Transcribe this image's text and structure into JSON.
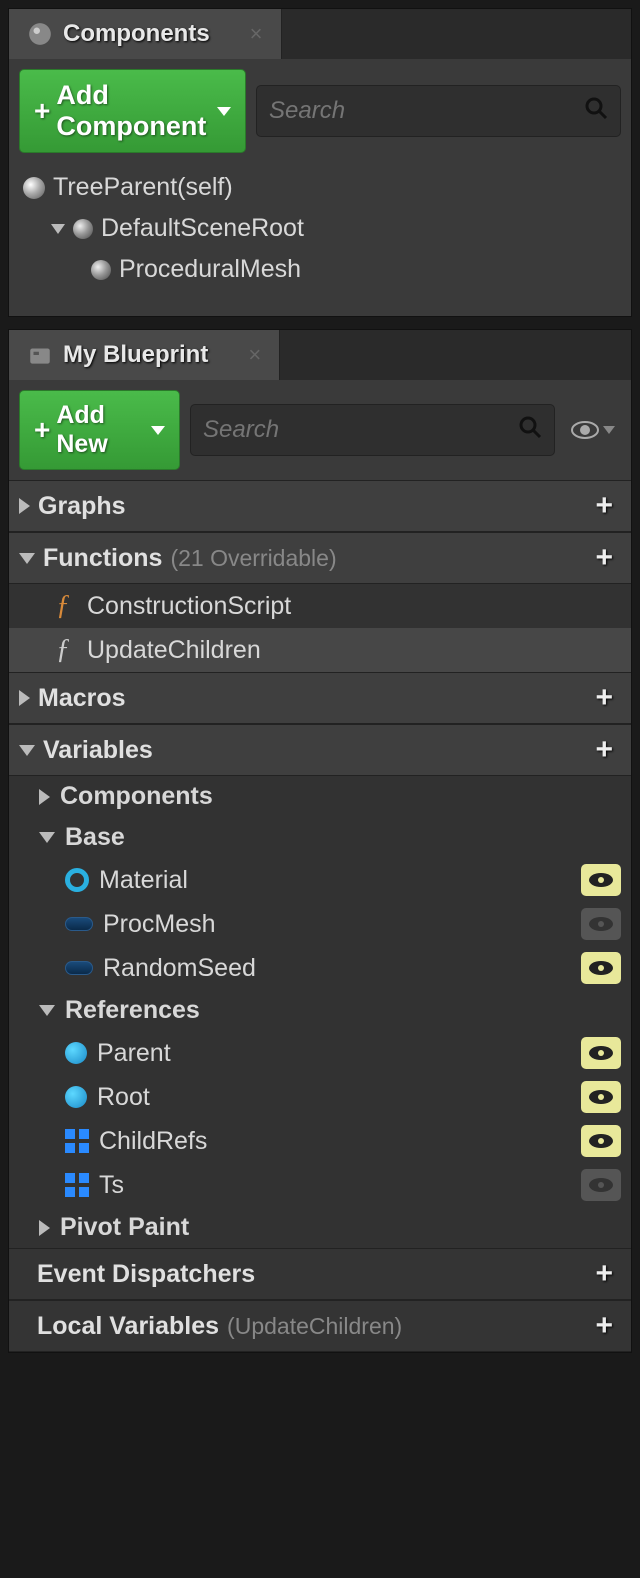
{
  "components": {
    "tab_title": "Components",
    "add_button": "Add Component",
    "search_placeholder": "Search",
    "tree": {
      "root": "TreeParent(self)",
      "scene_root": "DefaultSceneRoot",
      "mesh": "ProceduralMesh"
    }
  },
  "blueprint": {
    "tab_title": "My Blueprint",
    "add_button": "Add New",
    "search_placeholder": "Search",
    "sections": {
      "graphs": {
        "title": "Graphs"
      },
      "functions": {
        "title": "Functions",
        "sub": "(21 Overridable)",
        "items": {
          "construction": "ConstructionScript",
          "update": "UpdateChildren"
        }
      },
      "macros": {
        "title": "Macros"
      },
      "variables": {
        "title": "Variables",
        "groups": {
          "components": "Components",
          "base": {
            "title": "Base",
            "material": "Material",
            "procmesh": "ProcMesh",
            "randomseed": "RandomSeed"
          },
          "references": {
            "title": "References",
            "parent": "Parent",
            "root": "Root",
            "childrefs": "ChildRefs",
            "ts": "Ts"
          },
          "pivot": "Pivot Paint"
        }
      },
      "dispatchers": {
        "title": "Event Dispatchers"
      },
      "locals": {
        "title": "Local Variables",
        "sub": "(UpdateChildren)"
      }
    }
  }
}
